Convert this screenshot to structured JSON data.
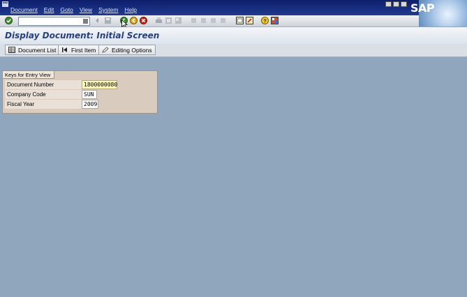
{
  "menubar": {
    "items": [
      "Document",
      "Edit",
      "Goto",
      "View",
      "System",
      "Help"
    ],
    "logo": "SAP"
  },
  "toolbar": {
    "command_field": {
      "value": ""
    },
    "icons": [
      "enter-icon",
      "save-icon",
      "back-icon",
      "exit-icon",
      "cancel-icon",
      "print-icon",
      "find-icon",
      "find-next-icon",
      "first-page-icon",
      "previous-page-icon",
      "next-page-icon",
      "last-page-icon",
      "create-session-icon",
      "shortcut-icon",
      "help-icon",
      "layout-icon"
    ]
  },
  "title": "Display Document: Initial Screen",
  "app_toolbar": {
    "document_list": "Document List",
    "first_item": "First Item",
    "editing_options": "Editing Options"
  },
  "keys_frame": {
    "title": "Keys for Entry View",
    "fields": [
      {
        "label": "Document Number",
        "value": "1800000080"
      },
      {
        "label": "Company Code",
        "value": "SUN"
      },
      {
        "label": "Fiscal Year",
        "value": "2009"
      }
    ]
  },
  "colors": {
    "menubar": "#0d1e6c",
    "background": "#8fa6bd",
    "title": "#27407c"
  }
}
